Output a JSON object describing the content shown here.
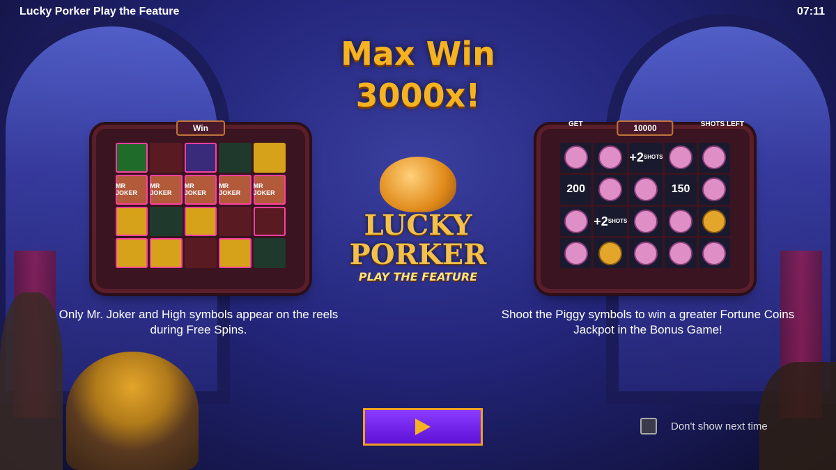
{
  "window": {
    "title": "Lucky Porker Play the Feature",
    "clock": "07:11"
  },
  "headline": {
    "line1": "Max Win",
    "line2": "3000x!"
  },
  "logo": {
    "line1": "LUCKY",
    "line2": "PORKER",
    "tagline": "PLAY THE FEATURE"
  },
  "left_panel": {
    "label": "Win",
    "reel_symbol_label": "MR JOKER",
    "description": "Only Mr. Joker and High symbols appear on the reels during Free Spins."
  },
  "right_panel": {
    "label": "10000",
    "left_note": "GET",
    "right_note": "SHOTS LEFT",
    "values": [
      "200",
      "150"
    ],
    "shots_bonus": "+2",
    "shots_word": "SHOTS",
    "description": "Shoot the Piggy symbols to win a greater Fortune Coins Jackpot in the Bonus Game!"
  },
  "controls": {
    "play_icon": "play-icon",
    "dont_show_label": "Don't show next time"
  },
  "colors": {
    "accent_gold": "#f5b321",
    "button_purple": "#6a1fe0",
    "background": "#23257a"
  }
}
